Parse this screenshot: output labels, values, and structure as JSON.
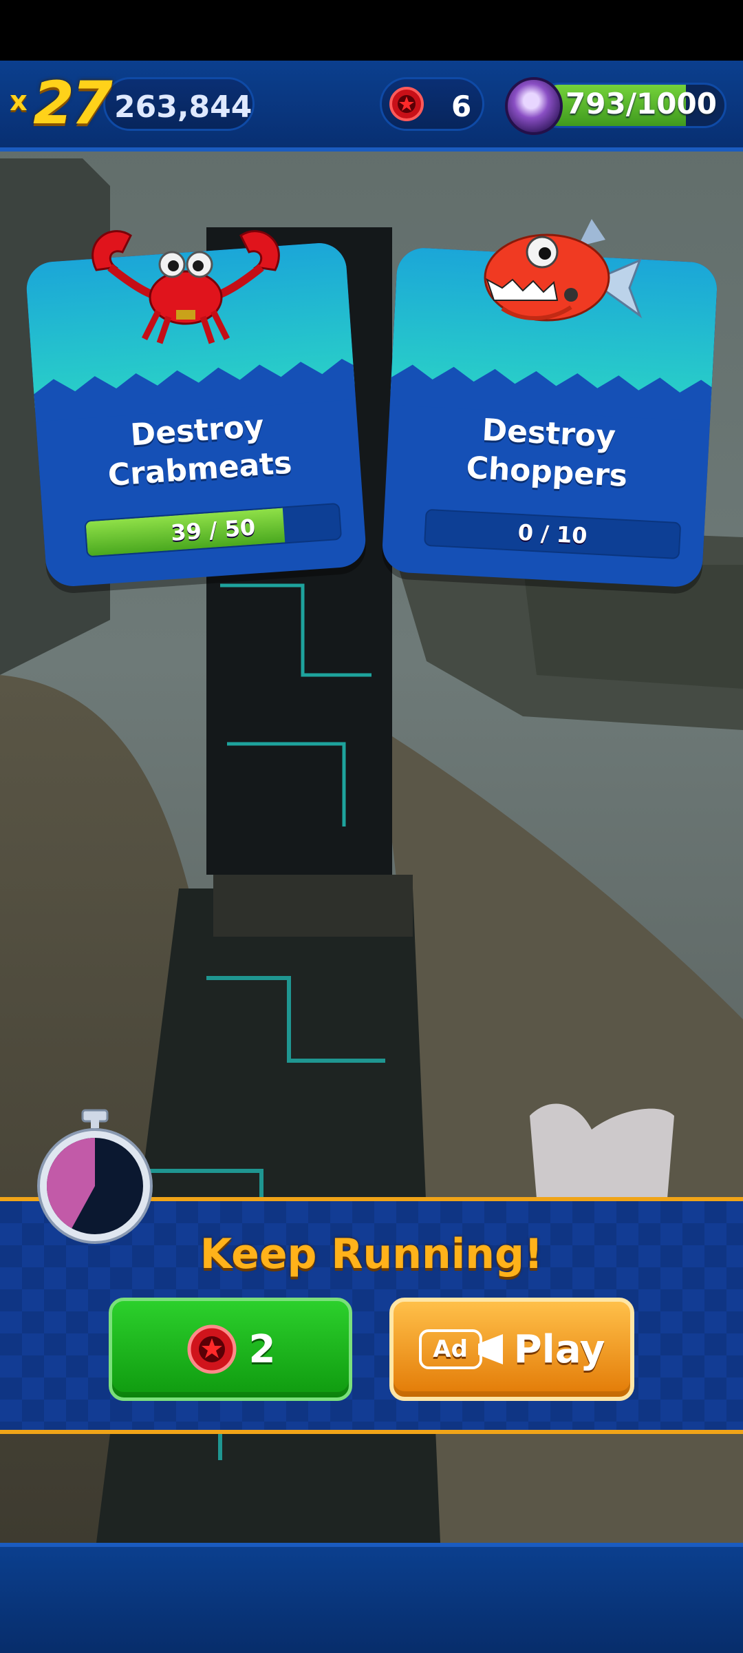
{
  "hud": {
    "multiplier_prefix": "x",
    "multiplier": "27",
    "score": "263,844",
    "red_rings": "6",
    "xp_text": "793/1000",
    "xp_progress": 0.793
  },
  "missions": [
    {
      "title_line1": "Destroy",
      "title_line2": "Crabmeats",
      "progress_text": "39 / 50",
      "progress": 0.78,
      "badnik": "crabmeat"
    },
    {
      "title_line1": "Destroy",
      "title_line2": "Choppers",
      "progress_text": "0 / 10",
      "progress": 0,
      "badnik": "chopper"
    }
  ],
  "continue": {
    "title": "Keep Running!",
    "rings_cost": "2",
    "play_label": "Play",
    "ad_label": "Ad",
    "timer_remaining": 0.42
  },
  "icons": {
    "red_ring": "red-ring-icon",
    "timer": "stopwatch-icon",
    "ad": "video-ad-icon"
  },
  "colors": {
    "hud_blue": "#0b3f8e",
    "accent_gold": "#ffb21a",
    "green_button": "#1fb81f",
    "orange_button": "#f0951e",
    "card_blue": "#1550b6"
  }
}
